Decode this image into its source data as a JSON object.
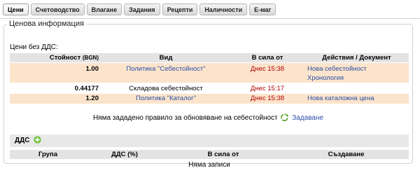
{
  "tabs": [
    {
      "label": "Цени",
      "active": true
    },
    {
      "label": "Счетоводство"
    },
    {
      "label": "Влагане"
    },
    {
      "label": "Задания"
    },
    {
      "label": "Рецепти"
    },
    {
      "label": "Наличности"
    },
    {
      "label": "Е-маг"
    }
  ],
  "price_info": {
    "legend": "Ценова информация",
    "subtitle": "Цени без ДДС:",
    "columns": {
      "cost": "Стойност",
      "currency": "(BGN)",
      "kind": "Вид",
      "valid_from": "В сила от",
      "actions": "Действия / Документ"
    },
    "rows": [
      {
        "value": "1.00",
        "kind": "Политика \"Себестойност\"",
        "valid_from": "Днес 15:38",
        "action1": "Нова себестойност",
        "action2": "Хронология"
      },
      {
        "value": "0.44177",
        "kind": "Складова себестойност",
        "valid_from": "Днес 15:17",
        "action1": "",
        "action2": ""
      },
      {
        "value": "1.20",
        "kind": "Политика \"Каталог\"",
        "valid_from": "Днес 15:38",
        "action1": "Нова каталожна цена",
        "action2": ""
      }
    ],
    "notice": "Няма зададено правило за обновяване на себестойност",
    "notice_link": "Задаване"
  },
  "vat": {
    "title": "ДДС",
    "columns": {
      "group": "Група",
      "vat_pct": "ДДС (%)",
      "valid_from": "В сила от",
      "created": "Създаване"
    },
    "empty": "Няма записи"
  },
  "colors": {
    "highlight_row": "#fbe4cb",
    "link": "#2b4fa8",
    "date_red": "#b00000",
    "header_gray": "#e3e3e3"
  }
}
